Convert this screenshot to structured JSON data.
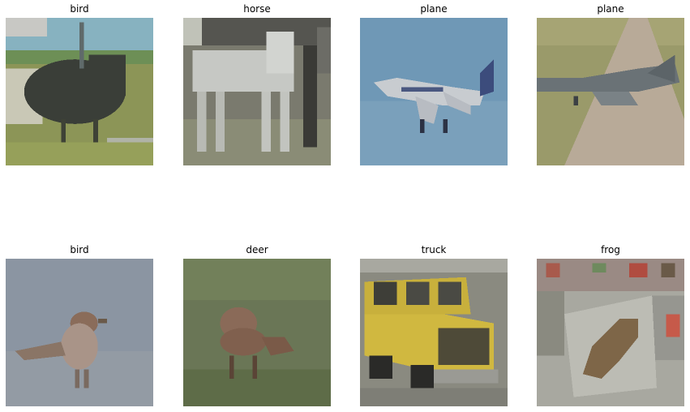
{
  "images": [
    {
      "label": "bird",
      "subject": "ostrich-photo"
    },
    {
      "label": "horse",
      "subject": "white-horse-photo"
    },
    {
      "label": "plane",
      "subject": "airliner-in-sky-photo"
    },
    {
      "label": "plane",
      "subject": "plane-on-runway-photo"
    },
    {
      "label": "bird",
      "subject": "sparrow-photo"
    },
    {
      "label": "deer",
      "subject": "deer-in-grass-photo"
    },
    {
      "label": "truck",
      "subject": "yellow-truck-photo"
    },
    {
      "label": "frog",
      "subject": "frog-on-floor-photo"
    }
  ]
}
